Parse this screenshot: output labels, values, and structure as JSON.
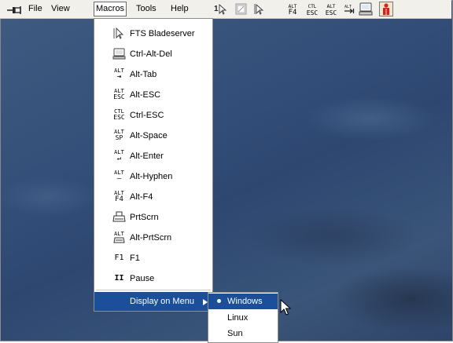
{
  "menubar": {
    "items": [
      "File",
      "View",
      "Macros",
      "Tools",
      "Help"
    ]
  },
  "toolbar": {
    "alt_f4": [
      "ALT",
      "F4"
    ],
    "ctl_esc": [
      "CTL",
      "ESC"
    ],
    "alt_esc": [
      "ALT",
      "ESC"
    ]
  },
  "macros_menu": {
    "items": [
      {
        "label": "FTS Bladeserver",
        "icon": "pointer-icon"
      },
      {
        "label": "Ctrl-Alt-Del",
        "icon": "monitor-icon"
      },
      {
        "label": "Alt-Tab",
        "icon": "alt-tab-icon",
        "glyph": [
          "ALT",
          "⇥"
        ]
      },
      {
        "label": "Alt-ESC",
        "icon": "alt-esc-icon",
        "glyph": [
          "ALT",
          "ESC"
        ]
      },
      {
        "label": "Ctrl-ESC",
        "icon": "ctl-esc-icon",
        "glyph": [
          "CTL",
          "ESC"
        ]
      },
      {
        "label": "Alt-Space",
        "icon": "alt-space-icon",
        "glyph": [
          "ALT",
          "SP"
        ]
      },
      {
        "label": "Alt-Enter",
        "icon": "alt-enter-icon",
        "glyph": [
          "ALT",
          "↵"
        ]
      },
      {
        "label": "Alt-Hyphen",
        "icon": "alt-hyphen-icon",
        "glyph": [
          "ALT",
          "—"
        ]
      },
      {
        "label": "Alt-F4",
        "icon": "alt-f4-icon",
        "glyph": [
          "ALT",
          "F4"
        ]
      },
      {
        "label": "PrtScrn",
        "icon": "printer-icon"
      },
      {
        "label": "Alt-PrtScrn",
        "icon": "alt-printer-icon",
        "glyph": [
          "ALT"
        ]
      },
      {
        "label": "F1",
        "icon": "f1-icon",
        "glyph": [
          "F1"
        ]
      },
      {
        "label": "Pause",
        "icon": "pause-icon",
        "glyph": [
          "II"
        ]
      }
    ],
    "display_on_menu": "Display on Menu"
  },
  "submenu": {
    "items": [
      "Windows",
      "Linux",
      "Sun"
    ],
    "selected": "Windows"
  },
  "colors": {
    "highlight": "#1c4f9a",
    "desktop": "#34507a"
  }
}
